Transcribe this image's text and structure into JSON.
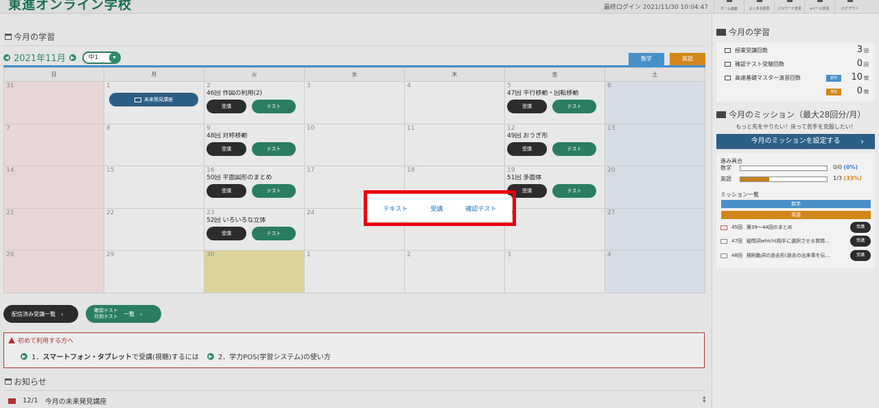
{
  "header": {
    "logo": "東進オンライン学校",
    "last_login": "最終ログイン 2021/11/30 10:04:47",
    "nav": [
      {
        "label": "ホーム画面",
        "icon": "home-icon"
      },
      {
        "label": "よくある質問",
        "icon": "question-icon"
      },
      {
        "label": "パスワード変更",
        "icon": "key-icon"
      },
      {
        "label": "eメール変更",
        "icon": "mail-icon"
      },
      {
        "label": "ログアウト",
        "icon": "logout-icon"
      }
    ]
  },
  "study": {
    "title": "今月の学習",
    "month": "2021年11月",
    "grade": "中1",
    "tabs": [
      {
        "label": "数学",
        "color": "#4a90c8"
      },
      {
        "label": "英語",
        "color": "#d4861a"
      }
    ],
    "weekdays": [
      "日",
      "月",
      "火",
      "水",
      "木",
      "金",
      "土"
    ],
    "weeks": [
      [
        {
          "day": "31",
          "type": "sun"
        },
        {
          "day": "1",
          "special": "未来発見講座"
        },
        {
          "day": "2",
          "lesson": "46回 作図の利用(2)"
        },
        {
          "day": "3"
        },
        {
          "day": "4"
        },
        {
          "day": "5",
          "lesson": "47回 平行移動・回転移動"
        },
        {
          "day": "6",
          "type": "sat"
        }
      ],
      [
        {
          "day": "7",
          "type": "sun"
        },
        {
          "day": "8"
        },
        {
          "day": "9",
          "lesson": "48回 対称移動"
        },
        {
          "day": "10"
        },
        {
          "day": "11"
        },
        {
          "day": "12",
          "lesson": "49回 おうぎ形"
        },
        {
          "day": "13",
          "type": "sat"
        }
      ],
      [
        {
          "day": "14",
          "type": "sun"
        },
        {
          "day": "15"
        },
        {
          "day": "16",
          "lesson": "50回 平面図形のまとめ"
        },
        {
          "day": "17"
        },
        {
          "day": "18"
        },
        {
          "day": "19",
          "lesson": "51回 多面体"
        },
        {
          "day": "20",
          "type": "sat"
        }
      ],
      [
        {
          "day": "21",
          "type": "sun"
        },
        {
          "day": "22"
        },
        {
          "day": "23",
          "lesson": "52回 いろいろな立体"
        },
        {
          "day": "24"
        },
        {
          "day": "25"
        },
        {
          "day": "26"
        },
        {
          "day": "27",
          "type": "sat"
        }
      ],
      [
        {
          "day": "28",
          "type": "sun"
        },
        {
          "day": "29"
        },
        {
          "day": "30",
          "type": "today"
        },
        {
          "day": "1"
        },
        {
          "day": "2"
        },
        {
          "day": "3"
        },
        {
          "day": "4",
          "type": "sat"
        }
      ]
    ],
    "attend_label": "受講",
    "test_label": "テスト",
    "list_buttons": {
      "delivered": "配信済み受講一覧",
      "tests_line1": "確認テスト",
      "tests_line2": "月例テスト",
      "tests_suffix": "一覧"
    }
  },
  "popup": {
    "items": [
      "テキスト",
      "受講",
      "確認テスト"
    ]
  },
  "notice": {
    "title": "初めて利用する方へ",
    "link1_prefix": "1．",
    "link1_bold": "スマートフォン・タブレット",
    "link1_rest": "で受講(視聴)するには",
    "link2": "2．学力POS(学習システム)の使い方"
  },
  "news": {
    "title": "お知らせ",
    "items": [
      {
        "date": "12/1",
        "text": "今月の未来発見講座"
      }
    ]
  },
  "side": {
    "study_title": "今月の学習",
    "stats": {
      "lectures_label": "授業受講回数",
      "lectures_value": "3",
      "lectures_unit": "回",
      "tests_label": "確認テスト受験回数",
      "tests_value": "0",
      "tests_unit": "回",
      "master_label": "高速基礎マスター演習回数",
      "master_math_badge": "数学",
      "master_math_value": "10",
      "master_math_unit": "問",
      "master_eng_badge": "英語",
      "master_eng_value": "0",
      "master_eng_unit": "問"
    },
    "mission_title": "今月のミッション（最大28回分/月）",
    "mission_sub": "もっと先をやりたい！戻って苦手を克服したい！",
    "mission_button": "今月のミッションを設定する",
    "progress_title": "進み具合",
    "progress": [
      {
        "subject": "数学",
        "text": "0/0",
        "pct": "(0%)",
        "fill": 0,
        "pct_color": "#2a7fd4"
      },
      {
        "subject": "英語",
        "text": "1/3",
        "pct": "(33%)",
        "fill": 0.33,
        "pct_color": "#d4861a"
      }
    ],
    "mission_list_title": "ミッション一覧",
    "mission_subjects": [
      {
        "label": "数学",
        "color": "#4a90c8"
      },
      {
        "label": "英語",
        "color": "#d4861a"
      }
    ],
    "missions": [
      {
        "num": "45回",
        "text": "第39〜44回のまとめ",
        "button": "受講"
      },
      {
        "num": "47回",
        "text": "疑問詞which(相手に選択させる質問…",
        "button": "受講"
      },
      {
        "num": "48回",
        "text": "規則動詞の過去形(過去の出来事を伝…",
        "button": "受講"
      }
    ]
  }
}
